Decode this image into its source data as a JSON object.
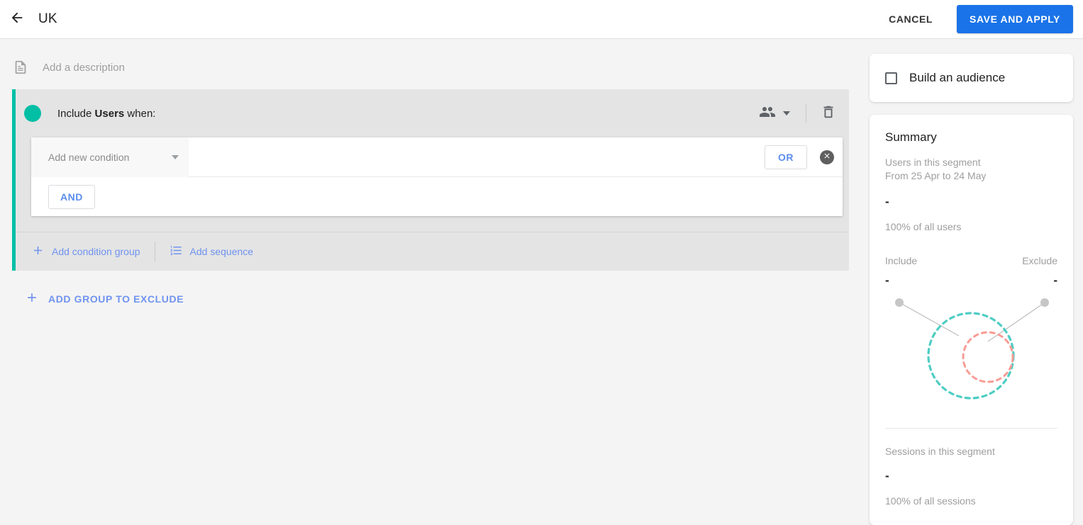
{
  "header": {
    "back_icon": "arrow-left-icon",
    "title": "UK",
    "cancel_label": "CANCEL",
    "save_label": "SAVE AND APPLY",
    "save_bg": "#1a73e8"
  },
  "description": {
    "icon": "document-icon",
    "placeholder": "Add a description"
  },
  "include_group": {
    "accent_color": "#00bfa5",
    "label_prefix": "Include",
    "label_strong": "Users",
    "label_suffix": "when:",
    "scope_icon": "people-icon",
    "scope_caret_icon": "chevron-down-icon",
    "delete_icon": "trash-icon",
    "condition": {
      "select_value": "Add new condition",
      "select_caret_icon": "chevron-down-icon",
      "or_label": "OR",
      "remove_icon": "close-circle-icon",
      "and_label": "AND"
    },
    "footer": {
      "add_condition_group": "Add condition group",
      "add_condition_group_icon": "plus-icon",
      "add_sequence": "Add sequence",
      "add_sequence_icon": "numbered-list-icon"
    }
  },
  "exclude": {
    "icon": "plus-icon",
    "label": "ADD GROUP TO EXCLUDE"
  },
  "right_panel": {
    "audience": {
      "checkbox_icon": "checkbox-unchecked-icon",
      "label": "Build an audience",
      "checked": false
    },
    "summary": {
      "title": "Summary",
      "users_label": "Users in this segment",
      "date_range": "From 25 Apr to 24 May",
      "users_value": "-",
      "users_percent": "100% of all users",
      "include_label": "Include",
      "exclude_label": "Exclude",
      "include_value": "-",
      "exclude_value": "-",
      "sessions_label": "Sessions in this segment",
      "sessions_value": "-",
      "sessions_percent": "100% of all sessions",
      "venn": {
        "include_circle_color": "#4ecdc4",
        "exclude_circle_color": "#f79c94",
        "connector_color": "#bdbdbd"
      }
    }
  }
}
